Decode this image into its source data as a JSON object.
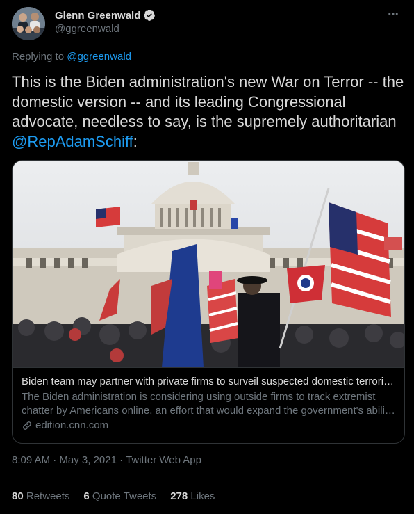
{
  "author": {
    "name": "Glenn Greenwald",
    "handle": "@ggreenwald",
    "verified_icon": "verified-badge-icon",
    "more_icon": "more-options-icon"
  },
  "reply": {
    "prefix": "Replying to",
    "mention": "@ggreenwald"
  },
  "tweet": {
    "text": "This is the Biden administration's new War on Terror -- the domestic version -- and its leading Congressional advocate, needless to say, is the supremely authoritarian",
    "mention": "@RepAdamSchiff",
    "suffix": ":"
  },
  "card": {
    "title": "Biden team may partner with private firms to surveil suspected domestic terrori…",
    "description": "The Biden administration is considering using outside firms to track extremist chatter by Americans online, an effort that would expand the government's abili…",
    "domain": "edition.cnn.com",
    "link_icon": "link-icon"
  },
  "meta": {
    "time": "8:09 AM",
    "date": "May 3, 2021",
    "source": "Twitter Web App",
    "separator": "·"
  },
  "stats": {
    "retweets_count": "80",
    "retweets_label": "Retweets",
    "quotes_count": "6",
    "quotes_label": "Quote Tweets",
    "likes_count": "278",
    "likes_label": "Likes"
  },
  "colors": {
    "background": "#000000",
    "text": "#d9d9d9",
    "secondary": "#6e767d",
    "accent": "#1d9bf0",
    "border": "#2f3336"
  }
}
